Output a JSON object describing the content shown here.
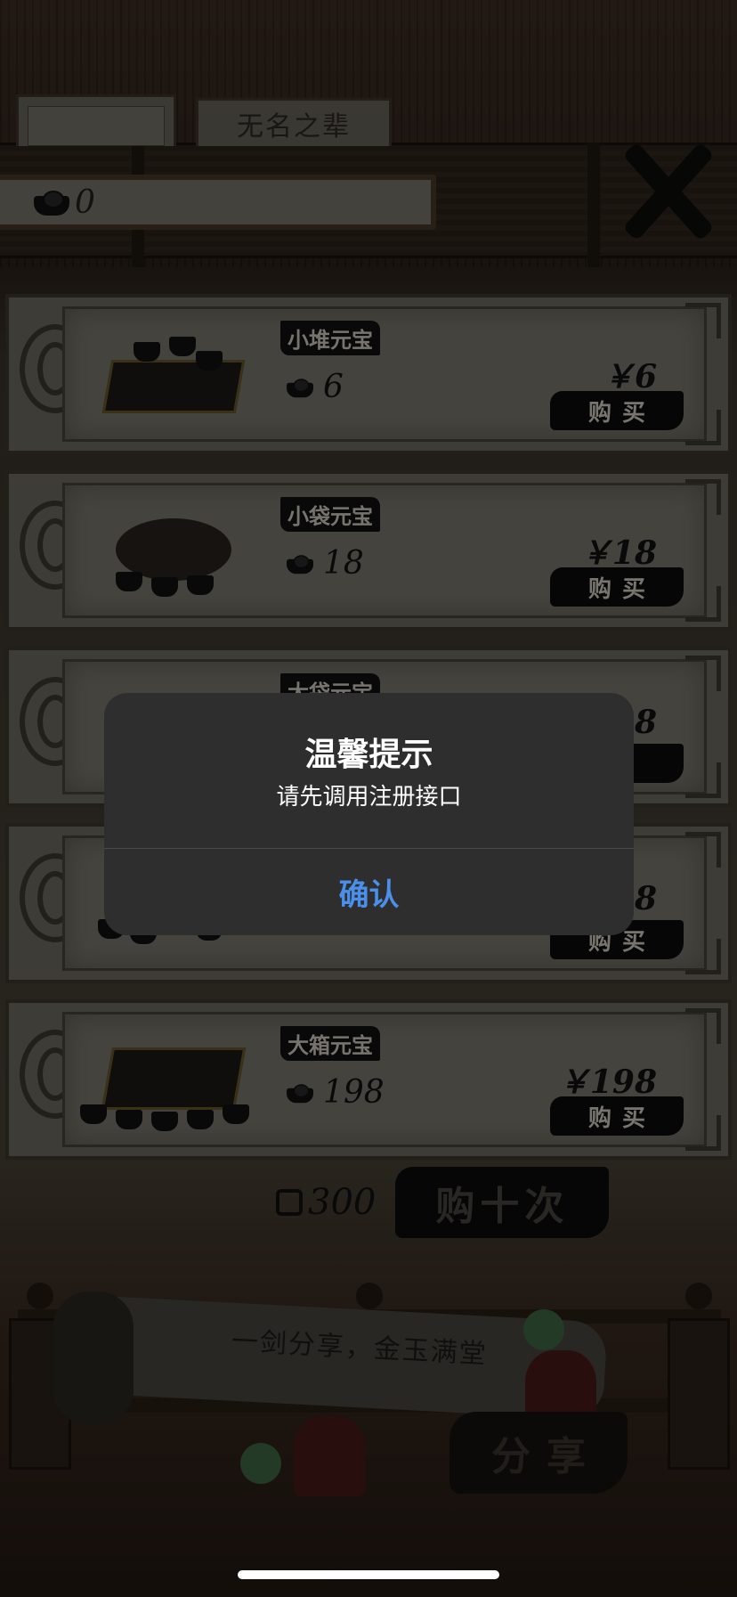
{
  "header": {
    "player_name": "无名之辈",
    "currency_value": "0"
  },
  "items": [
    {
      "title": "小堆元宝",
      "amount": "6",
      "price": "￥6",
      "buy_label": "购买"
    },
    {
      "title": "小袋元宝",
      "amount": "18",
      "price": "￥18",
      "buy_label": "购买"
    },
    {
      "title": "大袋元宝",
      "amount": "",
      "price": "8",
      "buy_label": "买"
    },
    {
      "title": "",
      "amount": "",
      "price": "28",
      "buy_label": "购买"
    },
    {
      "title": "大箱元宝",
      "amount": "198",
      "price": "￥198",
      "buy_label": "购买"
    }
  ],
  "buy_ten": {
    "cost": "300",
    "label": "购十次"
  },
  "share": {
    "slogan": "一剑分享，金玉满堂",
    "label": "分享"
  },
  "alert": {
    "title": "温馨提示",
    "message": "请先调用注册接口",
    "confirm_label": "确认",
    "confirm_color": "#4a8fea"
  },
  "icons": [
    "ingot-icon",
    "close-icon",
    "share-sword-icon"
  ]
}
